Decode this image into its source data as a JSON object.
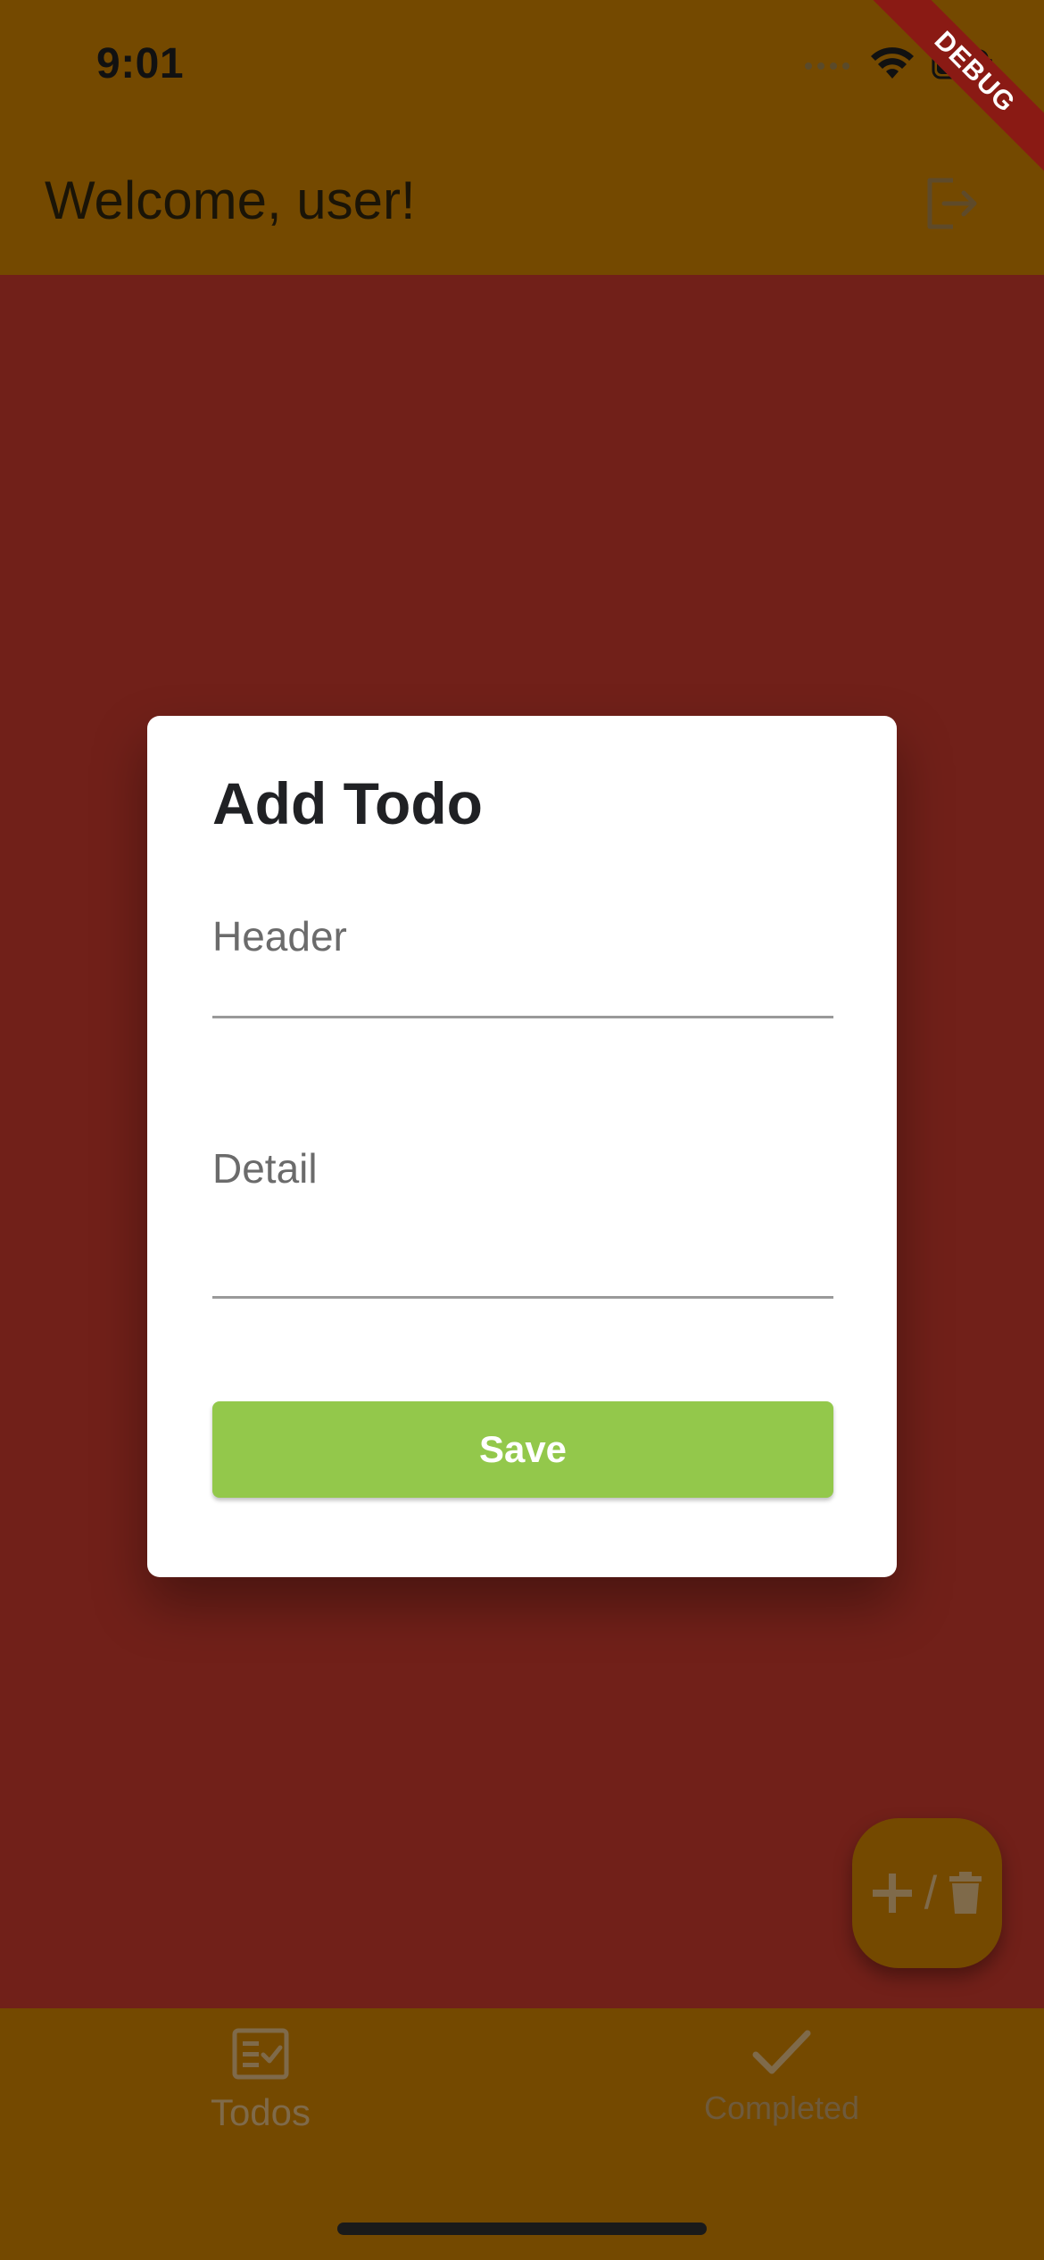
{
  "status_bar": {
    "time": "9:01",
    "debug_badge": "DEBUG"
  },
  "app_bar": {
    "title": "Welcome, user!",
    "logout_icon": "logout-icon"
  },
  "dialog": {
    "title": "Add Todo",
    "header_label": "Header",
    "detail_label": "Detail",
    "header_value": "",
    "detail_value": "",
    "save_label": "Save"
  },
  "fab": {
    "separator": "/",
    "icons": [
      "plus-icon",
      "trash-icon"
    ]
  },
  "bottom_nav": {
    "items": [
      {
        "label": "Todos",
        "icon": "todo-list-icon"
      },
      {
        "label": "Completed",
        "icon": "check-icon"
      }
    ]
  },
  "colors": {
    "scrim_background": "#712019",
    "app_bar": "#744900",
    "save_button": "#93c84b",
    "dialog_background": "#ffffff"
  }
}
